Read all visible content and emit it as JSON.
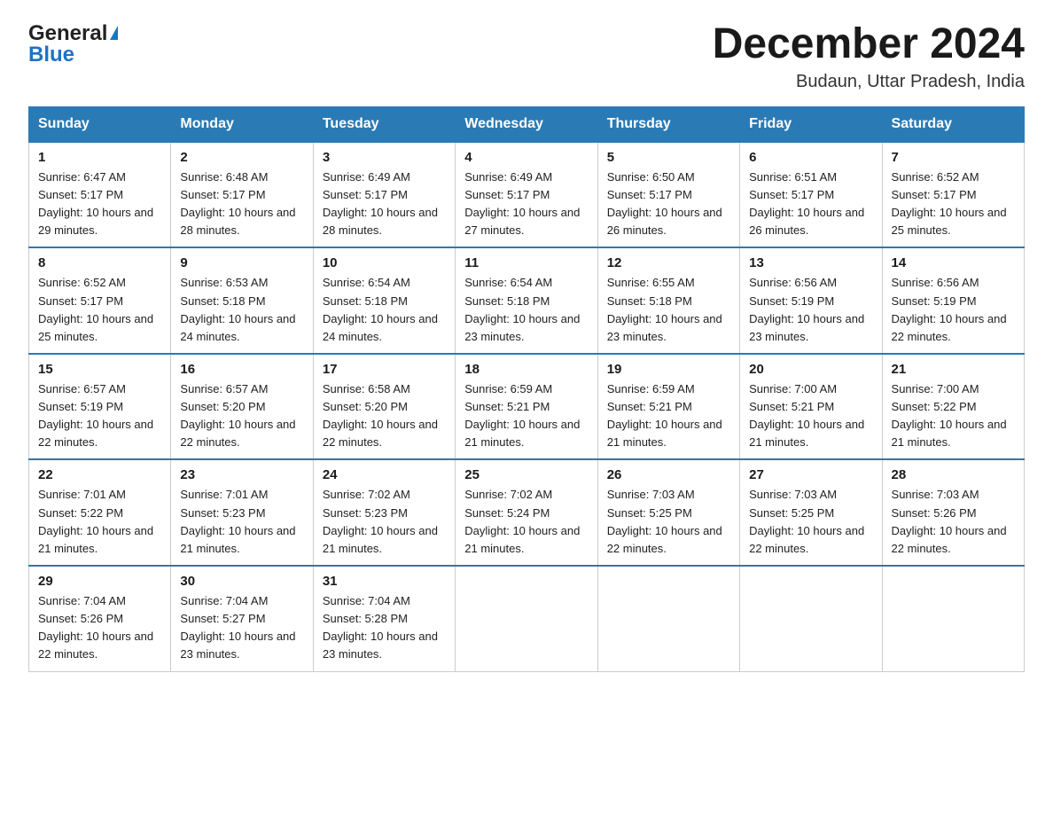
{
  "header": {
    "title": "December 2024",
    "subtitle": "Budaun, Uttar Pradesh, India",
    "logo_general": "General",
    "logo_blue": "Blue"
  },
  "days_of_week": [
    "Sunday",
    "Monday",
    "Tuesday",
    "Wednesday",
    "Thursday",
    "Friday",
    "Saturday"
  ],
  "weeks": [
    [
      {
        "num": "1",
        "sunrise": "6:47 AM",
        "sunset": "5:17 PM",
        "daylight": "10 hours and 29 minutes."
      },
      {
        "num": "2",
        "sunrise": "6:48 AM",
        "sunset": "5:17 PM",
        "daylight": "10 hours and 28 minutes."
      },
      {
        "num": "3",
        "sunrise": "6:49 AM",
        "sunset": "5:17 PM",
        "daylight": "10 hours and 28 minutes."
      },
      {
        "num": "4",
        "sunrise": "6:49 AM",
        "sunset": "5:17 PM",
        "daylight": "10 hours and 27 minutes."
      },
      {
        "num": "5",
        "sunrise": "6:50 AM",
        "sunset": "5:17 PM",
        "daylight": "10 hours and 26 minutes."
      },
      {
        "num": "6",
        "sunrise": "6:51 AM",
        "sunset": "5:17 PM",
        "daylight": "10 hours and 26 minutes."
      },
      {
        "num": "7",
        "sunrise": "6:52 AM",
        "sunset": "5:17 PM",
        "daylight": "10 hours and 25 minutes."
      }
    ],
    [
      {
        "num": "8",
        "sunrise": "6:52 AM",
        "sunset": "5:17 PM",
        "daylight": "10 hours and 25 minutes."
      },
      {
        "num": "9",
        "sunrise": "6:53 AM",
        "sunset": "5:18 PM",
        "daylight": "10 hours and 24 minutes."
      },
      {
        "num": "10",
        "sunrise": "6:54 AM",
        "sunset": "5:18 PM",
        "daylight": "10 hours and 24 minutes."
      },
      {
        "num": "11",
        "sunrise": "6:54 AM",
        "sunset": "5:18 PM",
        "daylight": "10 hours and 23 minutes."
      },
      {
        "num": "12",
        "sunrise": "6:55 AM",
        "sunset": "5:18 PM",
        "daylight": "10 hours and 23 minutes."
      },
      {
        "num": "13",
        "sunrise": "6:56 AM",
        "sunset": "5:19 PM",
        "daylight": "10 hours and 23 minutes."
      },
      {
        "num": "14",
        "sunrise": "6:56 AM",
        "sunset": "5:19 PM",
        "daylight": "10 hours and 22 minutes."
      }
    ],
    [
      {
        "num": "15",
        "sunrise": "6:57 AM",
        "sunset": "5:19 PM",
        "daylight": "10 hours and 22 minutes."
      },
      {
        "num": "16",
        "sunrise": "6:57 AM",
        "sunset": "5:20 PM",
        "daylight": "10 hours and 22 minutes."
      },
      {
        "num": "17",
        "sunrise": "6:58 AM",
        "sunset": "5:20 PM",
        "daylight": "10 hours and 22 minutes."
      },
      {
        "num": "18",
        "sunrise": "6:59 AM",
        "sunset": "5:21 PM",
        "daylight": "10 hours and 21 minutes."
      },
      {
        "num": "19",
        "sunrise": "6:59 AM",
        "sunset": "5:21 PM",
        "daylight": "10 hours and 21 minutes."
      },
      {
        "num": "20",
        "sunrise": "7:00 AM",
        "sunset": "5:21 PM",
        "daylight": "10 hours and 21 minutes."
      },
      {
        "num": "21",
        "sunrise": "7:00 AM",
        "sunset": "5:22 PM",
        "daylight": "10 hours and 21 minutes."
      }
    ],
    [
      {
        "num": "22",
        "sunrise": "7:01 AM",
        "sunset": "5:22 PM",
        "daylight": "10 hours and 21 minutes."
      },
      {
        "num": "23",
        "sunrise": "7:01 AM",
        "sunset": "5:23 PM",
        "daylight": "10 hours and 21 minutes."
      },
      {
        "num": "24",
        "sunrise": "7:02 AM",
        "sunset": "5:23 PM",
        "daylight": "10 hours and 21 minutes."
      },
      {
        "num": "25",
        "sunrise": "7:02 AM",
        "sunset": "5:24 PM",
        "daylight": "10 hours and 21 minutes."
      },
      {
        "num": "26",
        "sunrise": "7:03 AM",
        "sunset": "5:25 PM",
        "daylight": "10 hours and 22 minutes."
      },
      {
        "num": "27",
        "sunrise": "7:03 AM",
        "sunset": "5:25 PM",
        "daylight": "10 hours and 22 minutes."
      },
      {
        "num": "28",
        "sunrise": "7:03 AM",
        "sunset": "5:26 PM",
        "daylight": "10 hours and 22 minutes."
      }
    ],
    [
      {
        "num": "29",
        "sunrise": "7:04 AM",
        "sunset": "5:26 PM",
        "daylight": "10 hours and 22 minutes."
      },
      {
        "num": "30",
        "sunrise": "7:04 AM",
        "sunset": "5:27 PM",
        "daylight": "10 hours and 23 minutes."
      },
      {
        "num": "31",
        "sunrise": "7:04 AM",
        "sunset": "5:28 PM",
        "daylight": "10 hours and 23 minutes."
      },
      null,
      null,
      null,
      null
    ]
  ]
}
